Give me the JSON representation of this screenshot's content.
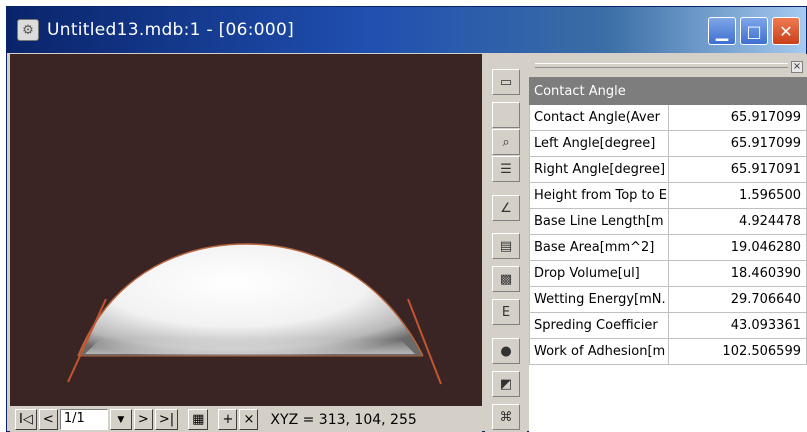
{
  "window": {
    "title": "Untitled13.mdb:1 - [06:000]"
  },
  "icons": {
    "app": "app-icon",
    "minimize": "minimize-icon",
    "maximize": "maximize-icon",
    "close": "close-icon"
  },
  "toolbar": {
    "tools": [
      "open-icon",
      "blank-icon",
      "zoom-icon",
      "document-icon",
      "angle-icon",
      "table-icon",
      "grid-icon",
      "edit-icon",
      "drop-icon",
      "image-icon",
      "camera-icon"
    ]
  },
  "statusbar": {
    "first": "I◁",
    "prev": "<",
    "frame": "1/1",
    "next": ">",
    "last": ">|",
    "plus": "+",
    "close": "×",
    "xyz": "XYZ = 313, 104, 255"
  },
  "results": {
    "header": "Contact Angle",
    "rows": [
      {
        "label": "Contact Angle(Aver",
        "value": "65.917099"
      },
      {
        "label": "Left Angle[degree]",
        "value": "65.917099"
      },
      {
        "label": "Right Angle[degree]",
        "value": "65.917091"
      },
      {
        "label": "Height from Top to E",
        "value": "1.596500"
      },
      {
        "label": "Base Line Length[m",
        "value": "4.924478"
      },
      {
        "label": "Base Area[mm^2]",
        "value": "19.046280"
      },
      {
        "label": "Drop Volume[ul]",
        "value": "18.460390"
      },
      {
        "label": "Wetting Energy[mN.",
        "value": "29.706640"
      },
      {
        "label": "Spreding Coefficier",
        "value": "43.093361"
      },
      {
        "label": "Work of Adhesion[m",
        "value": "102.506599"
      }
    ]
  },
  "colors": {
    "background": "#3a2424",
    "tangent": "#c25530",
    "titlebar": "#0a246a"
  }
}
